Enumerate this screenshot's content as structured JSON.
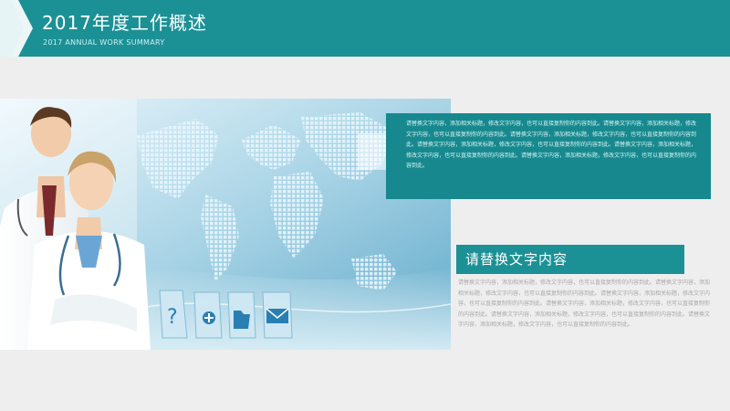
{
  "header": {
    "title": "2017年度工作概述",
    "subtitle": "2017 ANNUAL WORK SUMMARY"
  },
  "hero": {
    "icons": [
      "help-icon",
      "add-document-icon",
      "open-folder-icon",
      "mail-icon"
    ]
  },
  "top_box": {
    "text": "请替换文字内容，添加相关标题，修改文字内容，也可以直接复制你的内容到此。请替换文字内容，添加相关标题，修改文字内容，也可以直接复制你的内容到此。请替换文字内容，添加相关标题，修改文字内容，也可以直接复制你的内容到此。请替换文字内容，添加相关标题，修改文字内容，也可以直接复制你的内容到此。请替换文字内容，添加相关标题，修改文字内容，也可以直接复制你的内容到此。请替换文字内容，添加相关标题，修改文字内容，也可以直接复制你的内容到此。"
  },
  "section": {
    "title": "请替换文字内容",
    "body": "请替换文字内容，添加相关标题，修改文字内容，也可以直接复制你的内容到此。请替换文字内容，添加相关标题，修改文字内容，也可以直接复制你的内容到此。请替换文字内容，添加相关标题，修改文字内容，也可以直接复制你的内容到此。请替换文字内容，添加相关标题，修改文字内容，也可以直接复制你的内容到此。请替换文字内容，添加相关标题，修改文字内容，也可以直接复制你的内容到此。请替换文字内容，添加相关标题，修改文字内容，也可以直接复制你的内容到此。"
  },
  "colors": {
    "accent": "#1b9196",
    "accent_dark": "#17898e",
    "background": "#eeeeef"
  }
}
